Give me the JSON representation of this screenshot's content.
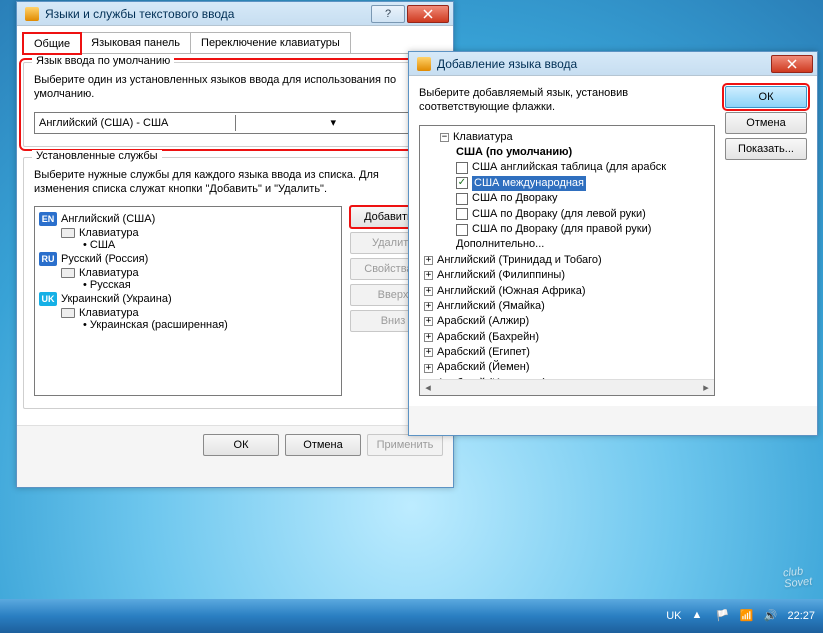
{
  "w1": {
    "title": "Языки и службы текстового ввода",
    "tabs": [
      "Общие",
      "Языковая панель",
      "Переключение клавиатуры"
    ],
    "group_default": {
      "title": "Язык ввода по умолчанию",
      "desc": "Выберите один из установленных языков ввода для использования по умолчанию.",
      "value": "Английский (США) - США"
    },
    "group_installed": {
      "title": "Установленные службы",
      "desc": "Выберите нужные службы для каждого языка ввода из списка. Для изменения списка служат кнопки \"Добавить\" и \"Удалить\".",
      "langs": [
        {
          "flag": "EN",
          "flag_class": "flag-en",
          "name": "Английский (США)",
          "kb_lbl": "Клавиатура",
          "layouts": [
            "США"
          ]
        },
        {
          "flag": "RU",
          "flag_class": "flag-ru",
          "name": "Русский (Россия)",
          "kb_lbl": "Клавиатура",
          "layouts": [
            "Русская"
          ]
        },
        {
          "flag": "UK",
          "flag_class": "flag-uk",
          "name": "Украинский (Украина)",
          "kb_lbl": "Клавиатура",
          "layouts": [
            "Украинская (расширенная)"
          ]
        }
      ],
      "buttons": {
        "add": "Добавить...",
        "remove": "Удалить",
        "props": "Свойства...",
        "up": "Вверх",
        "down": "Вниз"
      }
    },
    "dlg_btns": {
      "ok": "ОК",
      "cancel": "Отмена",
      "apply": "Применить"
    }
  },
  "w2": {
    "title": "Добавление языка ввода",
    "desc": "Выберите добавляемый язык, установив соответствующие флажки.",
    "kb_header": "Клавиатура",
    "default_label": "США (по умолчанию)",
    "layouts": [
      {
        "label": "США английская таблица (для арабск",
        "checked": false,
        "selected": false
      },
      {
        "label": "США международная",
        "checked": true,
        "selected": true
      },
      {
        "label": "США по Двораку",
        "checked": false,
        "selected": false
      },
      {
        "label": "США по Двораку (для левой руки)",
        "checked": false,
        "selected": false
      },
      {
        "label": "США по Двораку (для правой руки)",
        "checked": false,
        "selected": false
      }
    ],
    "more": "Дополнительно...",
    "collapsed": [
      "Английский (Тринидад и Тобаго)",
      "Английский (Филиппины)",
      "Английский (Южная Африка)",
      "Английский (Ямайка)",
      "Арабский (Алжир)",
      "Арабский (Бахрейн)",
      "Арабский (Египет)",
      "Арабский (Йемен)",
      "Арабский (Иордания)"
    ],
    "btns": {
      "ok": "ОК",
      "cancel": "Отмена",
      "show": "Показать..."
    }
  },
  "taskbar": {
    "lang": "UK",
    "time": "22:27"
  },
  "watermark": {
    "l1": "club",
    "l2": "Sovet"
  }
}
